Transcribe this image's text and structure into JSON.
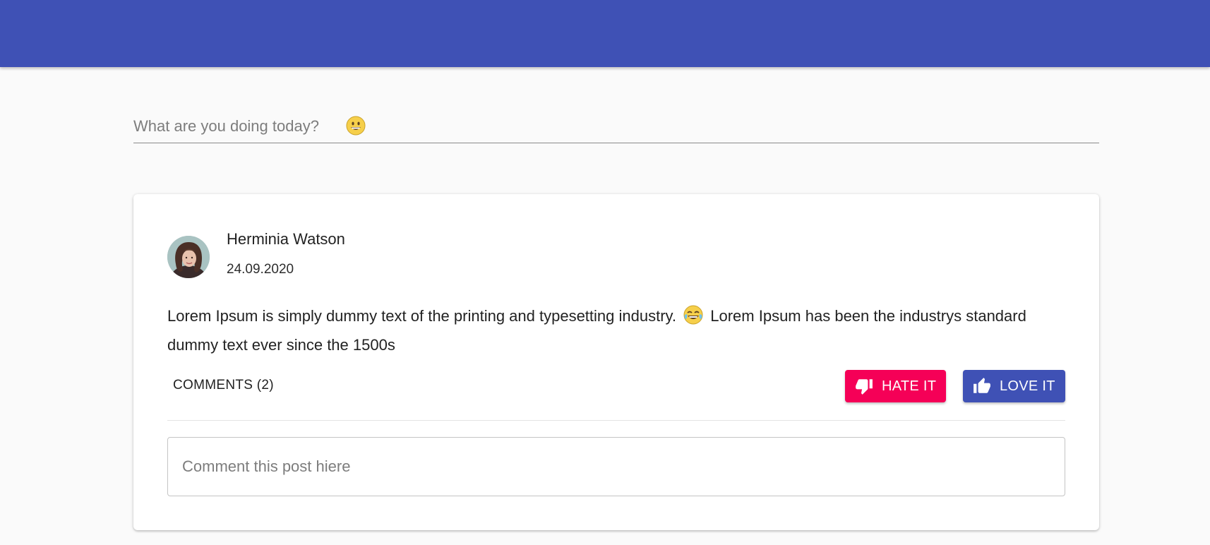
{
  "colors": {
    "appbar": "#3f51b5",
    "hate_button": "#f50057",
    "love_button": "#3f51b5",
    "background": "#fafafa"
  },
  "status": {
    "placeholder": "What are you doing today?",
    "placeholder_emoji_icon": "grinning-face-icon"
  },
  "post": {
    "author_name": "Herminia Watson",
    "date": "24.09.2020",
    "text_before_emoji": "Lorem Ipsum is simply dummy text of the printing and typesetting industry.",
    "emoji_icon": "tears-of-joy-face-icon",
    "text_after_emoji": "Lorem Ipsum has been the industrys standard dummy text ever since the 1500s",
    "comments_label": "COMMENTS (2)",
    "hate_label": "HATE IT",
    "hate_icon": "thumb-down-icon",
    "love_label": "LOVE IT",
    "love_icon": "thumb-up-icon",
    "comment_placeholder": "Comment this post hiere"
  }
}
